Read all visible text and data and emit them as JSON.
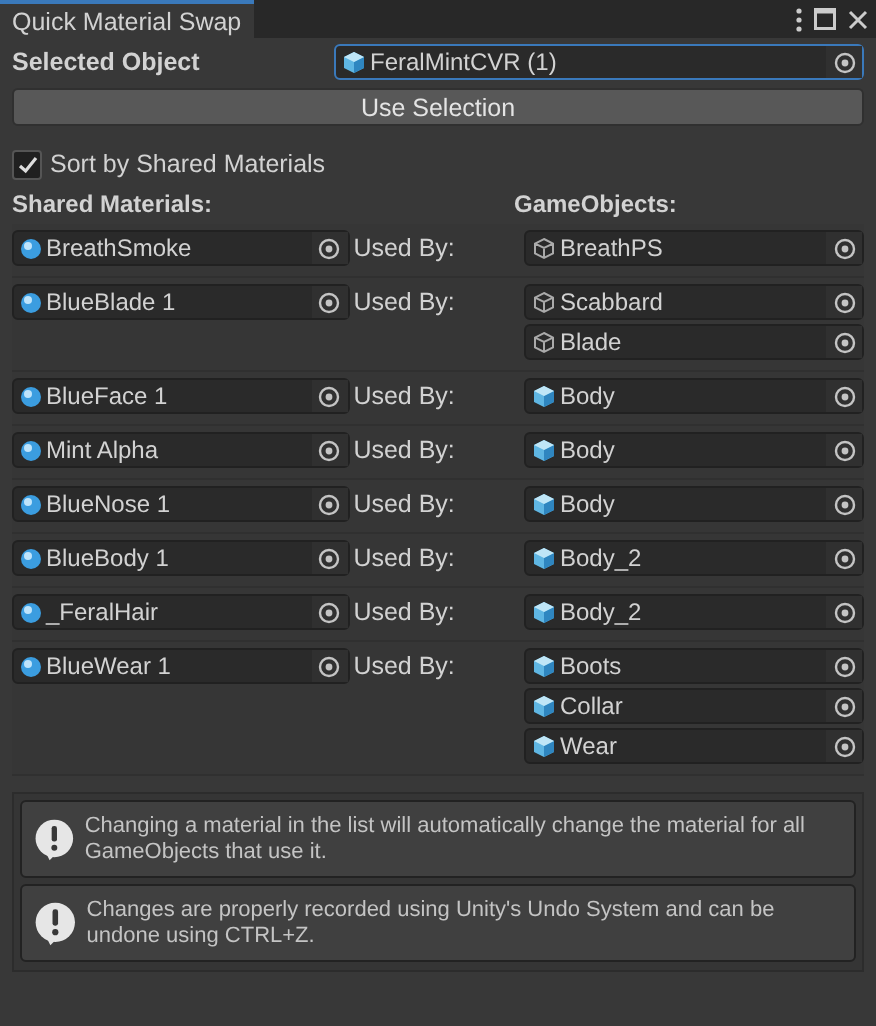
{
  "window": {
    "tab": "Quick Material Swap",
    "tab_selected": true
  },
  "selected_object": {
    "label": "Selected Object",
    "value": "FeralMintCVR (1)",
    "kind": "mesh"
  },
  "use_selection_button": "Use Selection",
  "sort_option": {
    "label": "Sort by Shared Materials",
    "checked": true
  },
  "headers": {
    "materials": "Shared Materials:",
    "objects": "GameObjects:"
  },
  "groups": [
    {
      "material": "BreathSmoke",
      "used_by": "Used By:",
      "objects": [
        {
          "name": "BreathPS",
          "kind": "empty"
        }
      ]
    },
    {
      "material": "BlueBlade 1",
      "used_by": "Used By:",
      "objects": [
        {
          "name": "Scabbard",
          "kind": "empty"
        },
        {
          "name": "Blade",
          "kind": "empty"
        }
      ]
    },
    {
      "material": "BlueFace 1",
      "used_by": "Used By:",
      "objects": [
        {
          "name": "Body",
          "kind": "mesh"
        }
      ]
    },
    {
      "material": "Mint Alpha",
      "used_by": "Used By:",
      "objects": [
        {
          "name": "Body",
          "kind": "mesh"
        }
      ]
    },
    {
      "material": "BlueNose 1",
      "used_by": "Used By:",
      "objects": [
        {
          "name": "Body",
          "kind": "mesh"
        }
      ]
    },
    {
      "material": "BlueBody 1",
      "used_by": "Used By:",
      "objects": [
        {
          "name": "Body_2",
          "kind": "mesh"
        }
      ]
    },
    {
      "material": "_FeralHair",
      "used_by": "Used By:",
      "objects": [
        {
          "name": "Body_2",
          "kind": "mesh"
        }
      ]
    },
    {
      "material": "BlueWear 1",
      "used_by": "Used By:",
      "objects": [
        {
          "name": "Boots",
          "kind": "mesh"
        },
        {
          "name": "Collar",
          "kind": "mesh"
        },
        {
          "name": "Wear",
          "kind": "mesh"
        }
      ]
    }
  ],
  "info_messages": [
    "Changing a material in the list will automatically change the material for all GameObjects that use it.",
    "Changes are properly recorded using Unity's Undo System and can be undone using CTRL+Z."
  ]
}
